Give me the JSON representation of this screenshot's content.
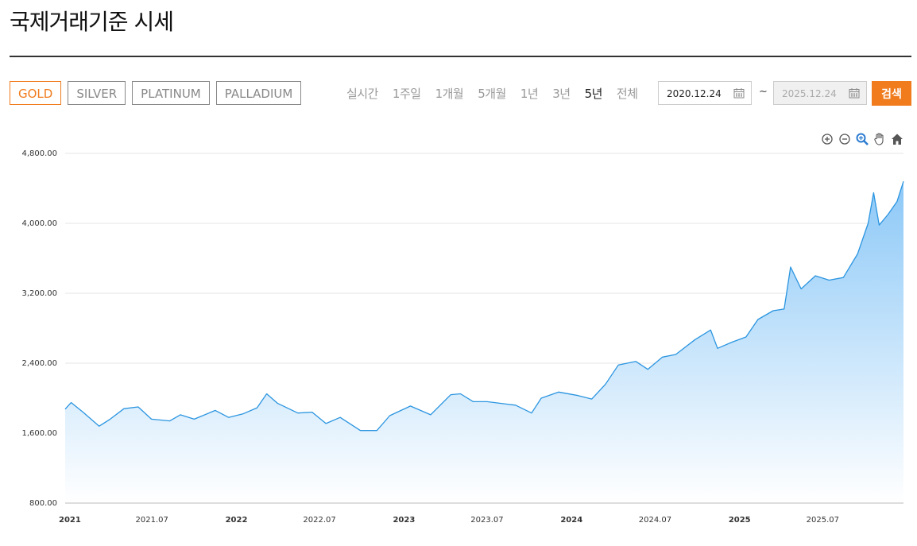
{
  "page": {
    "title": "국제거래기준 시세"
  },
  "metals": [
    {
      "label": "GOLD",
      "active": true
    },
    {
      "label": "SILVER",
      "active": false
    },
    {
      "label": "PLATINUM",
      "active": false
    },
    {
      "label": "PALLADIUM",
      "active": false
    }
  ],
  "periods": [
    {
      "label": "실시간",
      "active": false
    },
    {
      "label": "1주일",
      "active": false
    },
    {
      "label": "1개월",
      "active": false
    },
    {
      "label": "5개월",
      "active": false
    },
    {
      "label": "1년",
      "active": false
    },
    {
      "label": "3년",
      "active": false
    },
    {
      "label": "5년",
      "active": true
    },
    {
      "label": "전체",
      "active": false
    }
  ],
  "date_range": {
    "start": "2020.12.24",
    "separator": "~",
    "end": "2025.12.24",
    "search_label": "검색"
  },
  "toolbar": {
    "icons": [
      "zoom-in-icon",
      "zoom-out-icon",
      "magnify-icon",
      "pan-hand-icon",
      "home-icon"
    ]
  },
  "colors": {
    "accent": "#f07c1e",
    "line": "#2b95e0",
    "area_top": "#8cc8f7",
    "area_bottom": "#ffffff"
  },
  "chart_data": {
    "type": "area",
    "title": "",
    "xlabel": "",
    "ylabel": "",
    "x_ticks": [
      {
        "label": "2021",
        "x": "2020-12-24",
        "bold": true
      },
      {
        "label": "2021.07",
        "x": "2021-07-01",
        "bold": false
      },
      {
        "label": "2022",
        "x": "2022-01-01",
        "bold": true
      },
      {
        "label": "2022.07",
        "x": "2022-07-01",
        "bold": false
      },
      {
        "label": "2023",
        "x": "2023-01-01",
        "bold": true
      },
      {
        "label": "2023.07",
        "x": "2023-07-01",
        "bold": false
      },
      {
        "label": "2024",
        "x": "2024-01-01",
        "bold": true
      },
      {
        "label": "2024.07",
        "x": "2024-07-01",
        "bold": false
      },
      {
        "label": "2025",
        "x": "2025-01-01",
        "bold": true
      },
      {
        "label": "2025.07",
        "x": "2025-07-01",
        "bold": false
      }
    ],
    "y_ticks": [
      "800.00",
      "1,600.00",
      "2,400.00",
      "3,200.00",
      "4,000.00",
      "4,800.00"
    ],
    "ylim": [
      800,
      4800
    ],
    "xlim": [
      "2020-12-24",
      "2025-12-24"
    ],
    "grid": true,
    "series": [
      {
        "x": [
          "2020-12-24",
          "2021-01-06",
          "2021-02-01",
          "2021-03-08",
          "2021-04-01",
          "2021-05-01",
          "2021-06-01",
          "2021-06-30",
          "2021-08-09",
          "2021-09-01",
          "2021-10-01",
          "2021-11-16",
          "2021-12-15",
          "2022-01-15",
          "2022-02-15",
          "2022-03-08",
          "2022-04-01",
          "2022-05-15",
          "2022-06-15",
          "2022-07-15",
          "2022-08-15",
          "2022-09-28",
          "2022-11-03",
          "2022-12-01",
          "2023-01-15",
          "2023-02-28",
          "2023-04-13",
          "2023-05-04",
          "2023-06-01",
          "2023-07-01",
          "2023-08-01",
          "2023-09-01",
          "2023-10-06",
          "2023-10-27",
          "2023-12-04",
          "2024-01-15",
          "2024-02-14",
          "2024-03-15",
          "2024-04-12",
          "2024-05-20",
          "2024-06-15",
          "2024-07-17",
          "2024-08-15",
          "2024-09-26",
          "2024-10-30",
          "2024-11-14",
          "2024-12-15",
          "2025-01-15",
          "2025-02-10",
          "2025-03-15",
          "2025-04-08",
          "2025-04-22",
          "2025-05-15",
          "2025-06-15",
          "2025-07-15",
          "2025-08-15",
          "2025-09-15",
          "2025-10-08",
          "2025-10-20",
          "2025-11-01",
          "2025-11-20",
          "2025-12-10",
          "2025-12-24"
        ],
        "y": [
          1875,
          1950,
          1840,
          1680,
          1760,
          1880,
          1900,
          1760,
          1740,
          1810,
          1760,
          1860,
          1780,
          1820,
          1890,
          2050,
          1940,
          1830,
          1840,
          1710,
          1780,
          1630,
          1630,
          1800,
          1910,
          1810,
          2040,
          2050,
          1960,
          1960,
          1940,
          1920,
          1830,
          2000,
          2070,
          2030,
          1990,
          2160,
          2380,
          2420,
          2330,
          2470,
          2500,
          2670,
          2780,
          2570,
          2640,
          2700,
          2900,
          3000,
          3020,
          3500,
          3250,
          3400,
          3350,
          3380,
          3650,
          4000,
          4350,
          3980,
          4100,
          4250,
          4480
        ]
      }
    ]
  }
}
